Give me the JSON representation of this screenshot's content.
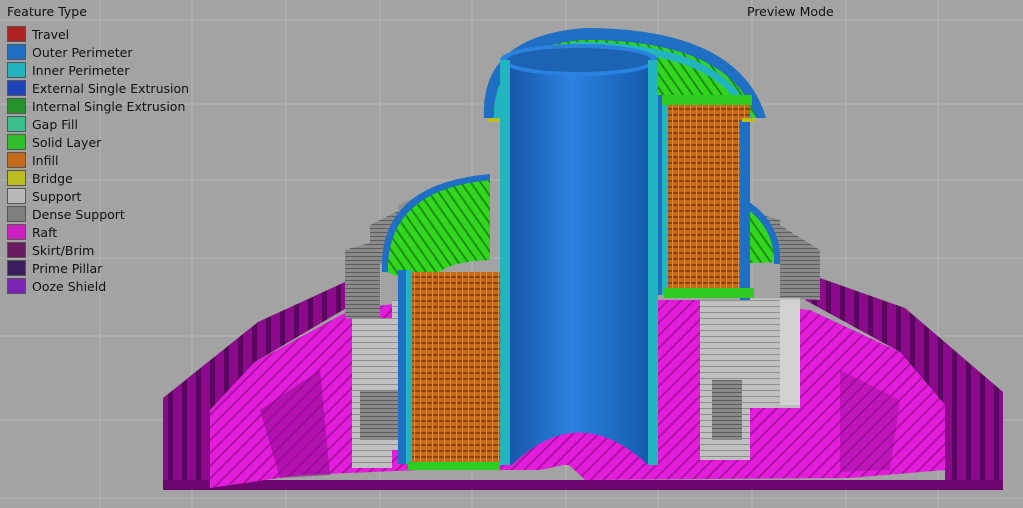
{
  "legend": {
    "title": "Feature Type",
    "items": [
      {
        "label": "Travel",
        "color": "#b22222"
      },
      {
        "label": "Outer Perimeter",
        "color": "#1f6fc4"
      },
      {
        "label": "Inner Perimeter",
        "color": "#22b5c0"
      },
      {
        "label": "External Single Extrusion",
        "color": "#1f44b8"
      },
      {
        "label": "Internal Single Extrusion",
        "color": "#23952b"
      },
      {
        "label": "Gap Fill",
        "color": "#3cbf8a"
      },
      {
        "label": "Solid Layer",
        "color": "#2ebf2a"
      },
      {
        "label": "Infill",
        "color": "#c4681a"
      },
      {
        "label": "Bridge",
        "color": "#bdbd22"
      },
      {
        "label": "Support",
        "color": "#b8b8b8"
      },
      {
        "label": "Dense Support",
        "color": "#7f7f7f"
      },
      {
        "label": "Raft",
        "color": "#c91ec0"
      },
      {
        "label": "Skirt/Brim",
        "color": "#6a1a60"
      },
      {
        "label": "Prime Pillar",
        "color": "#3a1d5c"
      },
      {
        "label": "Ooze Shield",
        "color": "#7a23b5"
      }
    ]
  },
  "preview_mode_label": "Preview Mode",
  "colors": {
    "background": "#a3a3a3",
    "grid": "#b6b6b6",
    "outer_perimeter": "#1f6fc4",
    "inner_perimeter": "#22b5c0",
    "solid_layer": "#2ecc1e",
    "infill": "#c4681a",
    "support": "#b8b8b8",
    "dense_support": "#7f7f7f",
    "raft": "#e21edb",
    "skirt": "#8a0a8a"
  }
}
